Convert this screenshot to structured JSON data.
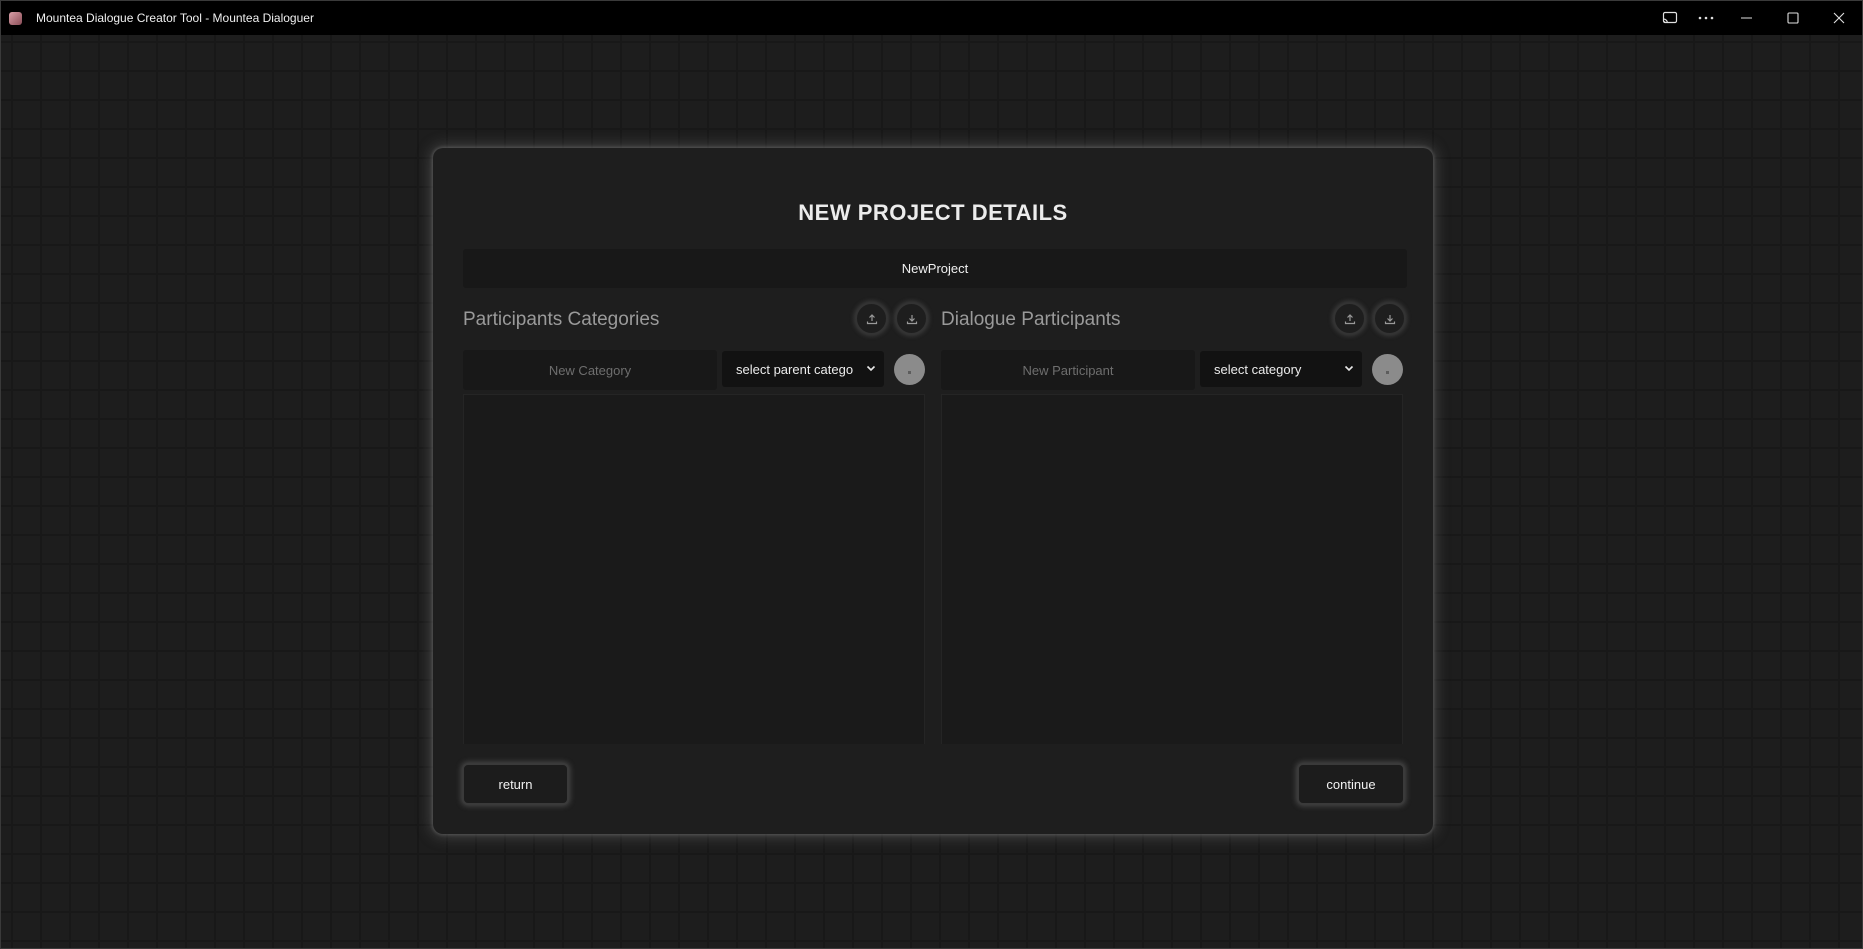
{
  "window": {
    "title": "Mountea Dialogue Creator Tool - Mountea Dialoguer",
    "controls": [
      "cast-icon",
      "more-icon",
      "minimize-icon",
      "maximize-icon",
      "close-icon"
    ]
  },
  "modal": {
    "title": "NEW PROJECT DETAILS",
    "project_name_value": "NewProject",
    "categories_panel": {
      "title": "Participants Categories",
      "input_placeholder": "New Category",
      "select_value": "select parent catego",
      "icons": [
        "upload-icon",
        "download-icon"
      ]
    },
    "participants_panel": {
      "title": "Dialogue Participants",
      "input_placeholder": "New Participant",
      "select_value": "select category",
      "icons": [
        "upload-icon",
        "download-icon"
      ]
    },
    "return_label": "return",
    "continue_label": "continue"
  },
  "colors": {
    "titlebar": "#000000",
    "background": "#1d1d1d",
    "modal": "#1e1e1e",
    "add_button": "#8b8b8b"
  }
}
